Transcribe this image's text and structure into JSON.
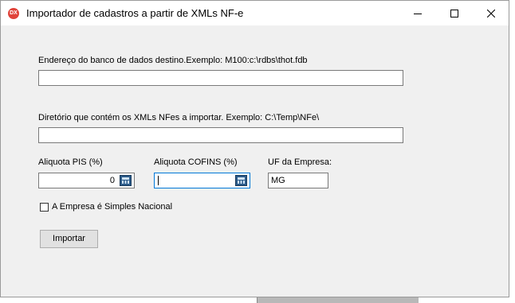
{
  "window": {
    "title": "Importador de cadastros a partir de XMLs NF-e",
    "icon_text": "DX"
  },
  "form": {
    "db_label": "Endereço do banco de dados destino.Exemplo: M100:c:\\rdbs\\thot.fdb",
    "db_value": "",
    "dir_label": "Diretório que contém os XMLs NFes a importar. Exemplo:  C:\\Temp\\NFe\\",
    "dir_value": "",
    "pis_label": "Aliquota PIS (%)",
    "pis_value": "0",
    "cofins_label": "Aliquota COFINS (%)",
    "cofins_value": "",
    "uf_label": "UF da Empresa:",
    "uf_value": "MG",
    "simples_label": "A Empresa é Simples Nacional",
    "simples_checked": false,
    "import_button": "Importar"
  },
  "icons": [
    "app-icon",
    "minimize-icon",
    "maximize-icon",
    "close-icon",
    "calculator-icon"
  ]
}
